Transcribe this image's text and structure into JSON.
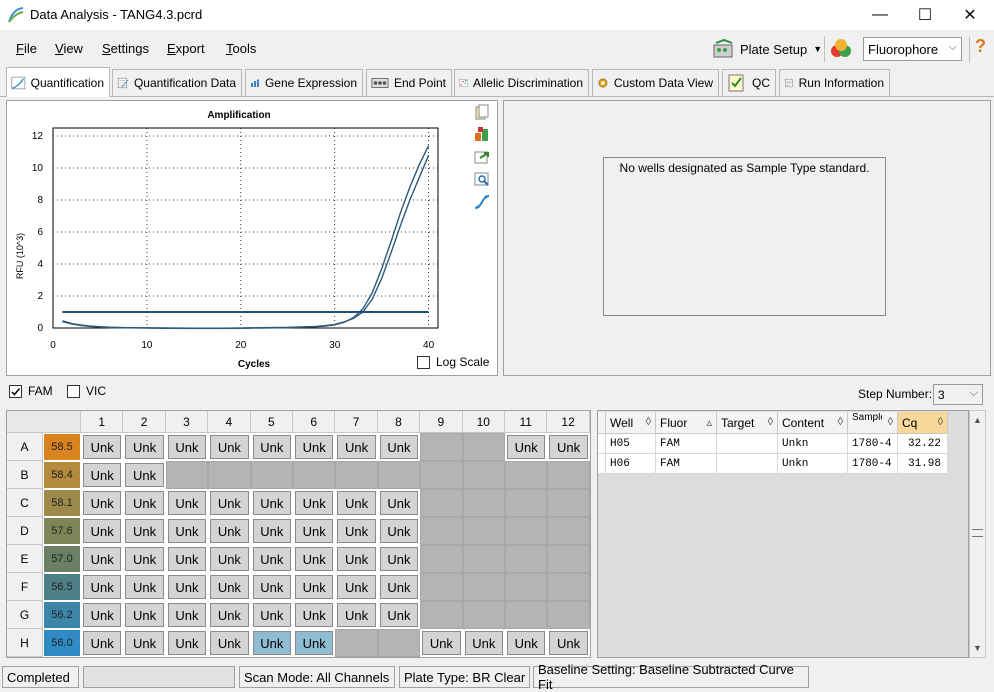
{
  "window": {
    "title": "Data Analysis - TANG4.3.pcrd",
    "minimize": "—",
    "maximize": "☐",
    "close": "✕"
  },
  "menu": [
    "File",
    "View",
    "Settings",
    "Export",
    "Tools"
  ],
  "menu_mnemonics": [
    "F",
    "V",
    "S",
    "E",
    "T"
  ],
  "toolbar": {
    "plate_setup": "Plate Setup",
    "fluorophore": "Fluorophore",
    "help": "?"
  },
  "tabs": [
    "Quantification",
    "Quantification Data",
    "Gene Expression",
    "End Point",
    "Allelic Discrimination",
    "Custom Data View",
    "QC",
    "Run Information"
  ],
  "chart_data": {
    "type": "line",
    "title": "Amplification",
    "xlabel": "Cycles",
    "ylabel": "RFU (10^3)",
    "xlim": [
      0,
      41
    ],
    "ylim": [
      0,
      12.5
    ],
    "xticks": [
      0,
      10,
      20,
      30,
      40
    ],
    "yticks": [
      0,
      2,
      4,
      6,
      8,
      10,
      12
    ],
    "grid": true,
    "threshold": 1.0,
    "series": [
      {
        "values_x": [
          1,
          2,
          3,
          4,
          5,
          6,
          8,
          10,
          12,
          15,
          18,
          20,
          22,
          25,
          28,
          29,
          30,
          31,
          32,
          33,
          34,
          35,
          36,
          37,
          38,
          39,
          40
        ],
        "values_y": [
          0.4,
          0.25,
          0.15,
          0.1,
          0.06,
          0.03,
          0.01,
          0,
          -0.02,
          -0.03,
          -0.03,
          -0.02,
          0,
          0.02,
          0.08,
          0.12,
          0.2,
          0.35,
          0.65,
          1.2,
          2.2,
          3.7,
          5.4,
          7.2,
          8.8,
          10.2,
          11.4
        ]
      },
      {
        "values_x": [
          1,
          2,
          3,
          4,
          5,
          6,
          8,
          10,
          12,
          15,
          18,
          20,
          22,
          25,
          28,
          29,
          30,
          31,
          32,
          33,
          34,
          35,
          36,
          37,
          38,
          39,
          40
        ],
        "values_y": [
          0.45,
          0.28,
          0.18,
          0.12,
          0.08,
          0.05,
          0.02,
          0.01,
          0,
          -0.01,
          -0.01,
          0,
          0.02,
          0.04,
          0.1,
          0.15,
          0.22,
          0.38,
          0.6,
          1.0,
          1.8,
          3.1,
          4.7,
          6.4,
          8.0,
          9.4,
          10.8
        ]
      }
    ]
  },
  "log_scale_label": "Log Scale",
  "std_message": "No wells designated as Sample Type standard.",
  "fluor_filters": [
    "FAM",
    "VIC"
  ],
  "fluor_checked": [
    true,
    false
  ],
  "step_number_label": "Step Number:",
  "step_number_value": "3",
  "plate": {
    "columns": [
      "1",
      "2",
      "3",
      "4",
      "5",
      "6",
      "7",
      "8",
      "9",
      "10",
      "11",
      "12"
    ],
    "rows": [
      "A",
      "B",
      "C",
      "D",
      "E",
      "F",
      "G",
      "H"
    ],
    "temps": [
      "58.5",
      "58.4",
      "58.1",
      "57.6",
      "57.0",
      "56.5",
      "56.2",
      "56.0"
    ],
    "temp_colors": [
      "#d9831f",
      "#b48a3e",
      "#9c8a4a",
      "#7f8457",
      "#6a7f63",
      "#4f7f87",
      "#3c87a8",
      "#2f8bc4"
    ],
    "cells": [
      [
        "Unk",
        "Unk",
        "Unk",
        "Unk",
        "Unk",
        "Unk",
        "Unk",
        "Unk",
        "",
        "",
        "Unk",
        "Unk"
      ],
      [
        "Unk",
        "Unk",
        "",
        "",
        "",
        "",
        "",
        "",
        "",
        "",
        "",
        ""
      ],
      [
        "Unk",
        "Unk",
        "Unk",
        "Unk",
        "Unk",
        "Unk",
        "Unk",
        "Unk",
        "",
        "",
        "",
        ""
      ],
      [
        "Unk",
        "Unk",
        "Unk",
        "Unk",
        "Unk",
        "Unk",
        "Unk",
        "Unk",
        "",
        "",
        "",
        ""
      ],
      [
        "Unk",
        "Unk",
        "Unk",
        "Unk",
        "Unk",
        "Unk",
        "Unk",
        "Unk",
        "",
        "",
        "",
        ""
      ],
      [
        "Unk",
        "Unk",
        "Unk",
        "Unk",
        "Unk",
        "Unk",
        "Unk",
        "Unk",
        "",
        "",
        "",
        ""
      ],
      [
        "Unk",
        "Unk",
        "Unk",
        "Unk",
        "Unk",
        "Unk",
        "Unk",
        "Unk",
        "",
        "",
        "",
        ""
      ],
      [
        "Unk",
        "Unk",
        "Unk",
        "Unk",
        "Unk",
        "Unk",
        "",
        "",
        "Unk",
        "Unk",
        "Unk",
        "Unk"
      ]
    ],
    "selected": [
      "H5",
      "H6"
    ]
  },
  "table": {
    "headers": [
      "Well",
      "Fluor",
      "Target",
      "Content",
      "Sample",
      "Cq"
    ],
    "rows": [
      [
        "H05",
        "FAM",
        "",
        "Unkn",
        "1780-4",
        "32.22"
      ],
      [
        "H06",
        "FAM",
        "",
        "Unkn",
        "1780-4",
        "31.98"
      ]
    ]
  },
  "status": {
    "state": "Completed",
    "scan_mode": "Scan Mode: All Channels",
    "plate_type": "Plate Type: BR Clear",
    "baseline": "Baseline Setting: Baseline Subtracted Curve Fit"
  }
}
